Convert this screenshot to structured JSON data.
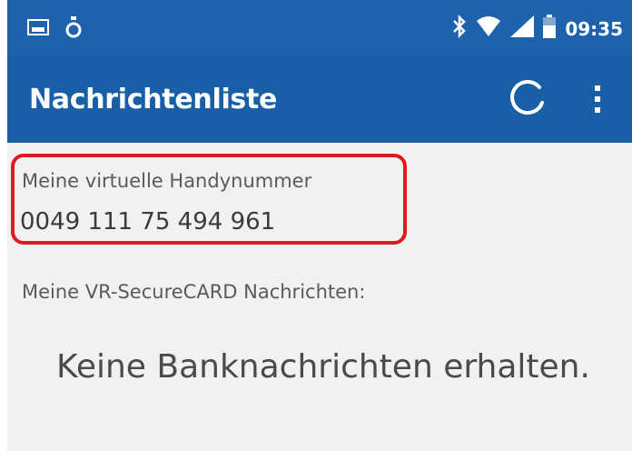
{
  "status_bar": {
    "time": "09:35",
    "icons": [
      "image-icon",
      "droplet-icon",
      "bluetooth-icon",
      "wifi-icon",
      "signal-icon",
      "battery-icon"
    ]
  },
  "app_bar": {
    "title": "Nachrichtenliste",
    "icons": [
      "refresh-icon",
      "more-vert-icon"
    ]
  },
  "content": {
    "virtual_number_label": "Meine virtuelle Handynummer",
    "virtual_number": "0049 111 75 494 961",
    "messages_label": "Meine VR-SecureCARD Nachrichten:",
    "empty_message": "Keine Banknachrichten erhalten."
  },
  "colors": {
    "status_bar": "#1c62ad",
    "app_bar": "#185fa8",
    "background": "#f1f1f1",
    "highlight": "#e0191e"
  }
}
